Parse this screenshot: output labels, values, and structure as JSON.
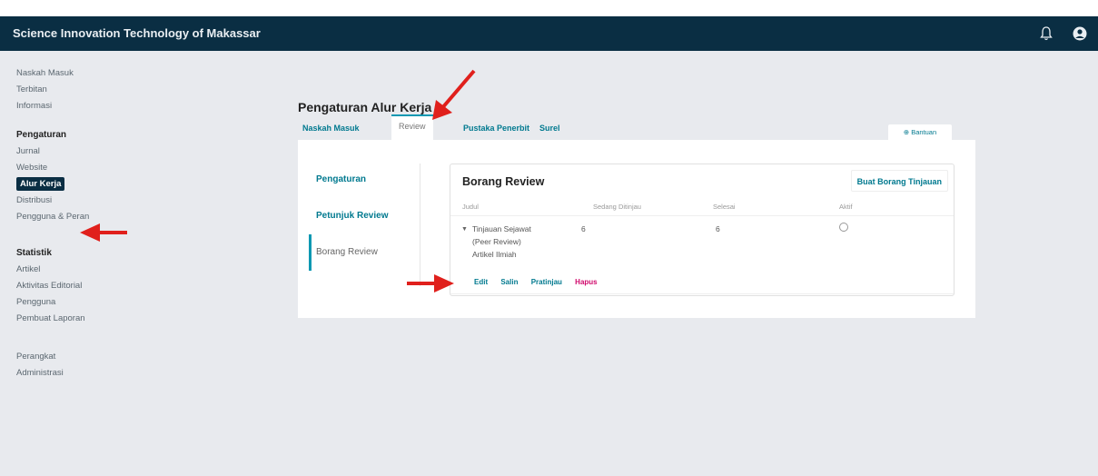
{
  "header": {
    "title": "Science Innovation Technology of Makassar",
    "icons": [
      "bell-icon",
      "user-avatar-icon"
    ]
  },
  "sidebar": {
    "group1": [
      "Naskah Masuk",
      "Terbitan",
      "Informasi"
    ],
    "settings_heading": "Pengaturan",
    "settings": [
      "Jurnal",
      "Website",
      "Alur Kerja",
      "Distribusi",
      "Pengguna & Peran"
    ],
    "stats_heading": "Statistik",
    "stats": [
      "Artikel",
      "Aktivitas Editorial",
      "Pengguna",
      "Pembuat Laporan"
    ],
    "tools": [
      "Perangkat",
      "Administrasi"
    ]
  },
  "main": {
    "page_title": "Pengaturan Alur Kerja",
    "tabs": [
      "Naskah Masuk",
      "Review",
      "Pustaka Penerbit",
      "Surel"
    ],
    "help_label": "⊕ Bantuan",
    "subnav": [
      "Pengaturan",
      "Petunjuk Review",
      "Borang Review"
    ],
    "card": {
      "title": "Borang Review",
      "create_button": "Buat Borang Tinjauan",
      "columns": [
        "Judul",
        "Sedang Ditinjau",
        "Selesai",
        "Aktif"
      ],
      "row": {
        "title_lines": [
          "Tinjauan Sejawat",
          "(Peer Review)",
          "Artikel Ilmiah"
        ],
        "in_review": "6",
        "completed": "6"
      },
      "actions": [
        "Edit",
        "Salin",
        "Pratinjau",
        "Hapus"
      ]
    }
  },
  "colors": {
    "topbar": "#0a2e43",
    "link": "#00798f",
    "accent": "#0a98b2",
    "danger": "#d00a6c",
    "annotation_arrow": "#e0201c"
  }
}
